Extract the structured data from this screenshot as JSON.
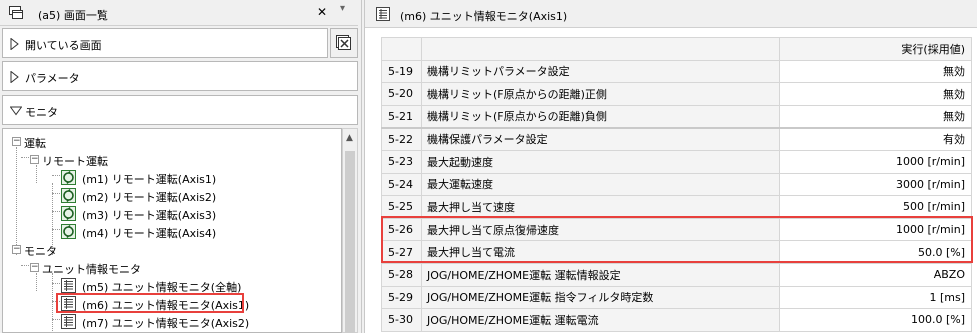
{
  "left_panel": {
    "title": "(a5) 画面一覧",
    "close_glyph": "✕",
    "dropdown_glyph": "▾",
    "sections": [
      {
        "label": "開いている画面",
        "expanded": false
      },
      {
        "label": "パラメータ",
        "expanded": false
      },
      {
        "label": "モニタ",
        "expanded": true
      }
    ],
    "tree": {
      "group1": {
        "label": "運転",
        "sign": "−"
      },
      "group1_child": {
        "label": "リモート運転",
        "sign": "−"
      },
      "remote_items": [
        "(m1) リモート運転(Axis1)",
        "(m2) リモート運転(Axis2)",
        "(m3) リモート運転(Axis3)",
        "(m4) リモート運転(Axis4)"
      ],
      "group2": {
        "label": "モニタ",
        "sign": "−"
      },
      "group2_child": {
        "label": "ユニット情報モニタ",
        "sign": "−"
      },
      "monitor_items": [
        "(m5) ユニット情報モニタ(全軸)",
        "(m6) ユニット情報モニタ(Axis1)",
        "(m7) ユニット情報モニタ(Axis2)"
      ]
    }
  },
  "right_panel": {
    "title": "(m6) ユニット情報モニタ(Axis1)",
    "column_header": "実行(採用値)",
    "rows": [
      {
        "no": "5-19",
        "name": "機構リミットパラメータ設定",
        "value": "無効"
      },
      {
        "no": "5-20",
        "name": "機構リミット(F原点からの距離)正側",
        "value": "無効"
      },
      {
        "no": "5-21",
        "name": "機構リミット(F原点からの距離)負側",
        "value": "無効"
      },
      {
        "no": "5-22",
        "name": "機構保護パラメータ設定",
        "value": "有効"
      },
      {
        "no": "5-23",
        "name": "最大起動速度",
        "value": "1000 [r/min]"
      },
      {
        "no": "5-24",
        "name": "最大運転速度",
        "value": "3000 [r/min]"
      },
      {
        "no": "5-25",
        "name": "最大押し当て速度",
        "value": "500 [r/min]"
      },
      {
        "no": "5-26",
        "name": "最大押し当て原点復帰速度",
        "value": "1000 [r/min]"
      },
      {
        "no": "5-27",
        "name": "最大押し当て電流",
        "value": "50.0 [%]"
      },
      {
        "no": "5-28",
        "name": "JOG/HOME/ZHOME運転 運転情報設定",
        "value": "ABZO"
      },
      {
        "no": "5-29",
        "name": "JOG/HOME/ZHOME運転 指令フィルタ時定数",
        "value": "1 [ms]"
      },
      {
        "no": "5-30",
        "name": "JOG/HOME/ZHOME運転 運転電流",
        "value": "100.0 [%]"
      }
    ],
    "colors": {
      "highlight": "#e8403c"
    }
  }
}
